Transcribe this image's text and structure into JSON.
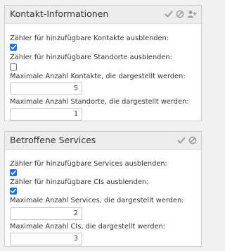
{
  "contact_panel": {
    "title": "Kontakt-Informationen",
    "header_icons": [
      "check-icon",
      "ban-icon",
      "add-user-icon"
    ],
    "fields": [
      {
        "label": "Zähler für hinzufügbare Kontakte ausblenden:",
        "type": "checkbox",
        "checked": true
      },
      {
        "label": "Zähler für hinzufügbare Standorte ausblenden:",
        "type": "checkbox",
        "checked": false
      },
      {
        "label": "Maximale Anzahl Kontakte, die dargestellt werden:",
        "type": "number",
        "value": "5"
      },
      {
        "label": "Maximale Anzahl Standorte, die dargestellt werden:",
        "type": "number",
        "value": "1"
      }
    ]
  },
  "services_panel": {
    "title": "Betroffene Services",
    "header_icons": [
      "check-icon",
      "ban-icon"
    ],
    "fields": [
      {
        "label": "Zähler für hinzufügbare Services ausblenden:",
        "type": "checkbox",
        "checked": true
      },
      {
        "label": "Zähler für hinzufügbare CIs ausblenden:",
        "type": "checkbox",
        "checked": true
      },
      {
        "label": "Maximale Anzahl Services, die dargestellt werden:",
        "type": "number",
        "value": "2"
      },
      {
        "label": "Maximale Anzahl CIs, die dargestellt werden:",
        "type": "number",
        "value": "3"
      }
    ]
  },
  "colors": {
    "checkbox_checked": "#1a73e8",
    "header_bg": "#ededed",
    "icon_gray": "#9a9a9a"
  }
}
